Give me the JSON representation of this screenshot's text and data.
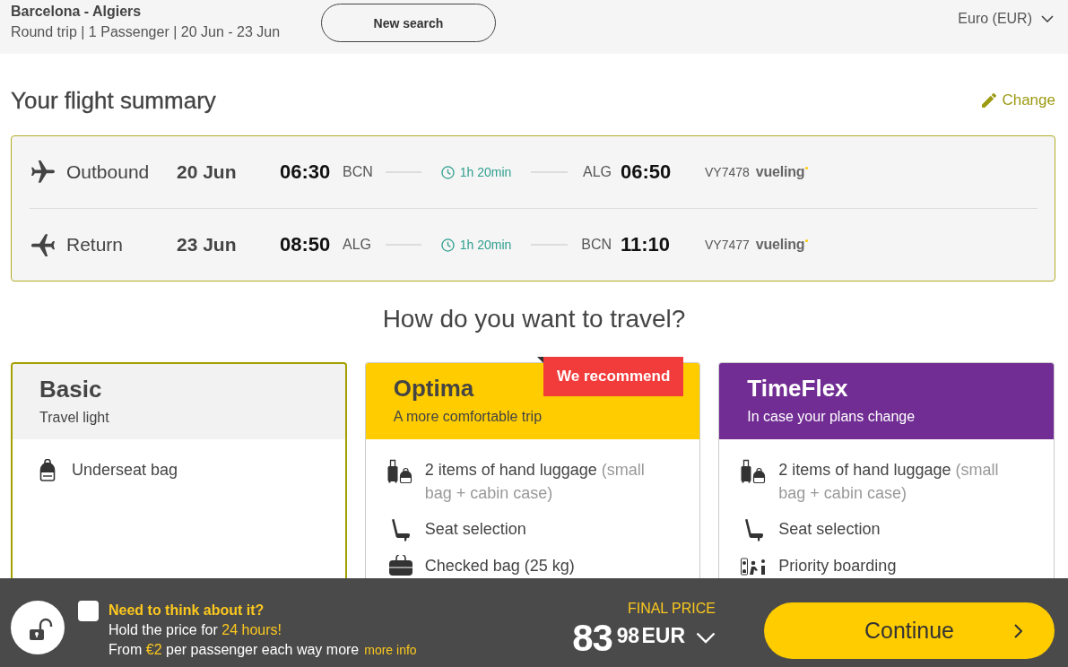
{
  "search_header": {
    "route": "Barcelona - Algiers",
    "details": "Round trip | 1 Passenger | 20 Jun - 23 Jun",
    "new_search_button": "New search",
    "currency": "Euro (EUR)"
  },
  "summary": {
    "title": "Your flight summary",
    "change_link": "Change",
    "flights": [
      {
        "kind": "outbound",
        "direction": "Outbound",
        "date": "20 Jun",
        "departure_time": "06:30",
        "departure_airport": "BCN",
        "duration": "1h 20min",
        "arrival_airport": "ALG",
        "arrival_time": "06:50",
        "flight_number": "VY7478",
        "airline": "vueling"
      },
      {
        "kind": "return",
        "direction": "Return",
        "date": "23 Jun",
        "departure_time": "08:50",
        "departure_airport": "ALG",
        "duration": "1h 20min",
        "arrival_airport": "BCN",
        "arrival_time": "11:10",
        "flight_number": "VY7477",
        "airline": "vueling"
      }
    ]
  },
  "fare_section": {
    "title": "How do you want to travel?",
    "fares": [
      {
        "name": "Basic",
        "tagline": "Travel light",
        "color": "#f2f2f2",
        "selected": true,
        "features": [
          {
            "kind": "backpack",
            "text": "Underseat bag"
          }
        ]
      },
      {
        "name": "Optima",
        "tagline": "A more comfortable trip",
        "color": "#ffcc00",
        "selected": false,
        "badge": "We recommend",
        "features": [
          {
            "kind": "hand-luggage",
            "text": "2 items of hand luggage",
            "note": "(small bag + cabin case)"
          },
          {
            "kind": "seat",
            "text": "Seat selection"
          },
          {
            "kind": "checked-bag",
            "text": "Checked bag (25 kg)"
          }
        ]
      },
      {
        "name": "TimeFlex",
        "tagline": "In case your plans change",
        "color": "#712d93",
        "selected": false,
        "features": [
          {
            "kind": "hand-luggage",
            "text": "2 items of hand luggage",
            "note": "(small bag + cabin case)"
          },
          {
            "kind": "seat",
            "text": "Seat selection"
          },
          {
            "kind": "priority",
            "text": "Priority boarding"
          }
        ]
      }
    ]
  },
  "hold_bar": {
    "checked": false,
    "title": "Need to think about it?",
    "line_1": "Hold the price for **24 hours!**",
    "line_2": "From **€2** per passenger each way more",
    "more_info_link": "more info"
  },
  "price": {
    "label": "FINAL PRICE",
    "integer": "83",
    "decimals": "98",
    "currency": "EUR"
  },
  "continue_button": "Continue"
}
